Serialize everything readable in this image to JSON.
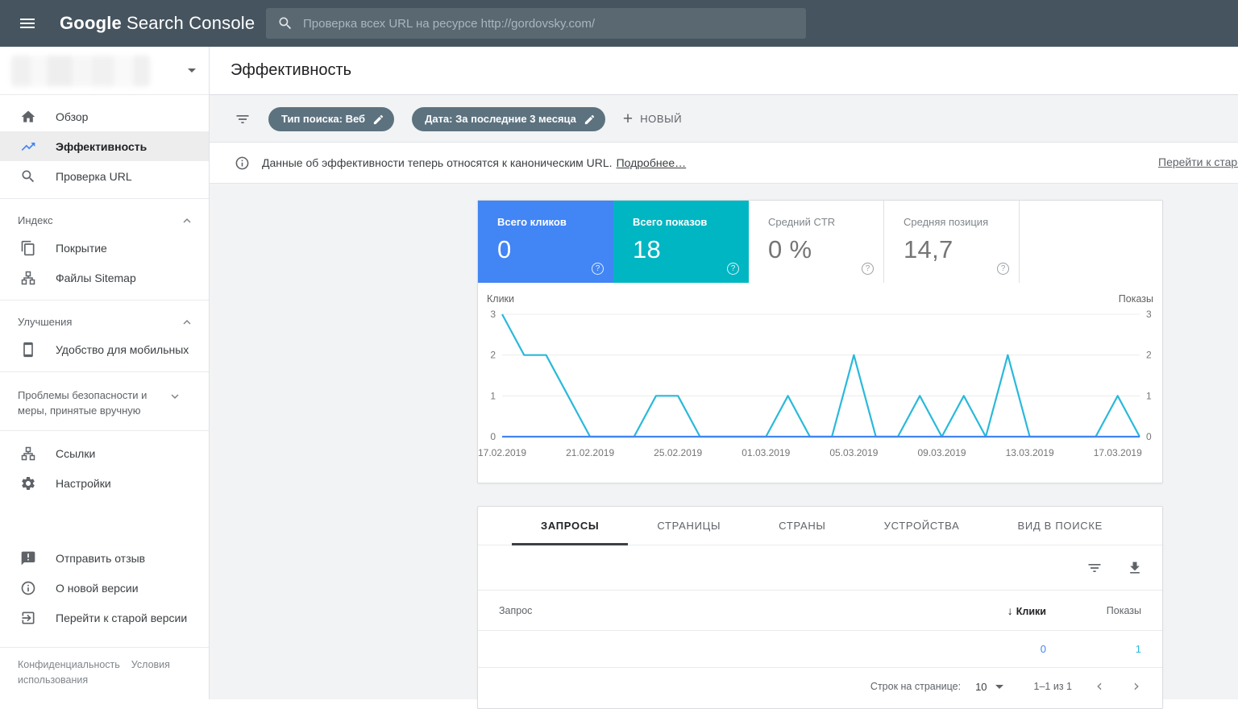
{
  "topbar": {
    "logo_google": "Google",
    "logo_rest": "Search Console",
    "search_placeholder": "Проверка всех URL на ресурсе http://gordovsky.com/"
  },
  "sidebar": {
    "nav": [
      {
        "label": "Обзор"
      },
      {
        "label": "Эффективность",
        "active": true
      },
      {
        "label": "Проверка URL"
      },
      {
        "label": "Покрытие"
      },
      {
        "label": "Файлы Sitemap"
      },
      {
        "label": "Удобство для мобильных"
      },
      {
        "label": "Ссылки"
      },
      {
        "label": "Настройки"
      },
      {
        "label": "Отправить отзыв"
      },
      {
        "label": "О новой версии"
      },
      {
        "label": "Перейти к старой версии"
      }
    ],
    "sections": {
      "index": "Индекс",
      "improvements": "Улучшения",
      "security": "Проблемы безопасности и меры, принятые вручную"
    },
    "footer": {
      "privacy": "Конфиденциальность",
      "terms": "Условия использования"
    }
  },
  "header": {
    "title": "Эффективность"
  },
  "filters": {
    "chips": [
      {
        "label": "Тип поиска: Веб"
      },
      {
        "label": "Дата: За последние 3 месяца"
      }
    ],
    "new_label": "НОВЫЙ"
  },
  "banner": {
    "text": "Данные об эффективности теперь относятся к каноническим URL.",
    "link": "Подробнее…",
    "right_link": "Перейти к старо"
  },
  "metrics": {
    "cards": [
      {
        "label": "Всего кликов",
        "value": "0",
        "color": "#4285f4",
        "selected": true
      },
      {
        "label": "Всего показов",
        "value": "18",
        "color": "#00b6c2",
        "selected": true
      },
      {
        "label": "Средний CTR",
        "value": "0 %",
        "selected": false
      },
      {
        "label": "Средняя позиция",
        "value": "14,7",
        "selected": false
      }
    ]
  },
  "chart_data": {
    "type": "line",
    "left_axis_label": "Клики",
    "right_axis_label": "Показы",
    "x": [
      "17.02.2019",
      "18.02.2019",
      "19.02.2019",
      "20.02.2019",
      "21.02.2019",
      "22.02.2019",
      "23.02.2019",
      "24.02.2019",
      "25.02.2019",
      "26.02.2019",
      "27.02.2019",
      "28.02.2019",
      "01.03.2019",
      "02.03.2019",
      "03.03.2019",
      "04.03.2019",
      "05.03.2019",
      "06.03.2019",
      "07.03.2019",
      "08.03.2019",
      "09.03.2019",
      "10.03.2019",
      "11.03.2019",
      "12.03.2019",
      "13.03.2019",
      "14.03.2019",
      "15.03.2019",
      "16.03.2019",
      "17.03.2019",
      "18.03.2019"
    ],
    "xtick_every": 4,
    "yticks": [
      0,
      1,
      2,
      3
    ],
    "ylim": [
      0,
      3
    ],
    "grid": true,
    "series": [
      {
        "name": "Клики",
        "color": "#4285f4",
        "values": [
          0,
          0,
          0,
          0,
          0,
          0,
          0,
          0,
          0,
          0,
          0,
          0,
          0,
          0,
          0,
          0,
          0,
          0,
          0,
          0,
          0,
          0,
          0,
          0,
          0,
          0,
          0,
          0,
          0,
          0
        ]
      },
      {
        "name": "Показы",
        "color": "#2ab9da",
        "values": [
          3,
          2,
          2,
          1,
          0,
          0,
          0,
          1,
          1,
          0,
          0,
          0,
          0,
          1,
          0,
          0,
          2,
          0,
          0,
          1,
          0,
          1,
          0,
          2,
          0,
          0,
          0,
          0,
          1,
          0
        ]
      }
    ]
  },
  "table": {
    "tabs": [
      {
        "label": "ЗАПРОСЫ",
        "active": true
      },
      {
        "label": "СТРАНИЦЫ",
        "active": false
      },
      {
        "label": "СТРАНЫ",
        "active": false
      },
      {
        "label": "УСТРОЙСТВА",
        "active": false
      },
      {
        "label": "ВИД В ПОИСКЕ",
        "active": false
      }
    ],
    "columns": {
      "query": "Запрос",
      "clicks": "Клики",
      "impressions": "Показы"
    },
    "rows": [
      {
        "clicks": "0",
        "impressions": "1"
      }
    ],
    "pagination": {
      "rows_label": "Строк на странице:",
      "rows_value": "10",
      "range": "1–1 из 1"
    }
  },
  "glyphs": {
    "plus": "+",
    "help": "?",
    "sort_down": "↓",
    "chevron_left": "‹",
    "chevron_right": "›"
  }
}
